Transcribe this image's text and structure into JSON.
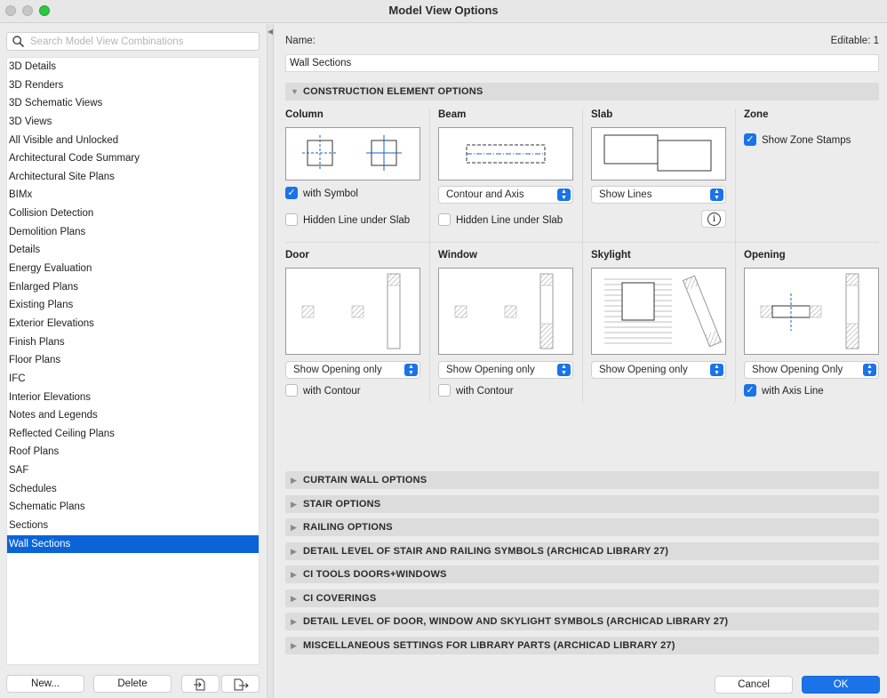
{
  "window": {
    "title": "Model View Options"
  },
  "search": {
    "placeholder": "Search Model View Combinations",
    "icon": "search-icon"
  },
  "list": {
    "items": [
      "3D Details",
      "3D Renders",
      "3D Schematic Views",
      "3D Views",
      "All Visible and Unlocked",
      "Architectural Code Summary",
      "Architectural Site Plans",
      "BIMx",
      "Collision Detection",
      "Demolition Plans",
      "Details",
      "Energy Evaluation",
      "Enlarged Plans",
      "Existing Plans",
      "Exterior Elevations",
      "Finish Plans",
      "Floor Plans",
      "IFC",
      "Interior Elevations",
      "Notes and Legends",
      "Reflected Ceiling Plans",
      "Roof Plans",
      "SAF",
      "Schedules",
      "Schematic Plans",
      "Sections",
      "Wall Sections"
    ],
    "selected": "Wall Sections"
  },
  "left_buttons": {
    "new": "New...",
    "delete": "Delete"
  },
  "header": {
    "name_label": "Name:",
    "editable": "Editable: 1",
    "name_value": "Wall Sections"
  },
  "construction": {
    "title": "CONSTRUCTION ELEMENT OPTIONS",
    "column": {
      "title": "Column",
      "with_symbol": "with Symbol",
      "hidden_line": "Hidden Line under Slab"
    },
    "beam": {
      "title": "Beam",
      "select": "Contour and Axis",
      "hidden_line": "Hidden Line under Slab"
    },
    "slab": {
      "title": "Slab",
      "select": "Show Lines"
    },
    "zone": {
      "title": "Zone",
      "show_stamps": "Show Zone Stamps"
    },
    "door": {
      "title": "Door",
      "select": "Show Opening only",
      "with_contour": "with Contour"
    },
    "window": {
      "title": "Window",
      "select": "Show Opening only",
      "with_contour": "with Contour"
    },
    "skylight": {
      "title": "Skylight",
      "select": "Show Opening only"
    },
    "opening": {
      "title": "Opening",
      "select": "Show Opening Only",
      "with_axis": "with Axis Line"
    }
  },
  "sections": [
    "CURTAIN WALL OPTIONS",
    "STAIR OPTIONS",
    "RAILING OPTIONS",
    "DETAIL LEVEL OF STAIR AND RAILING SYMBOLS (ARCHICAD LIBRARY 27)",
    "CI TOOLS DOORS+WINDOWS",
    "CI COVERINGS",
    "DETAIL LEVEL OF DOOR, WINDOW AND SKYLIGHT SYMBOLS (ARCHICAD LIBRARY 27)",
    "MISCELLANEOUS SETTINGS FOR LIBRARY PARTS (ARCHICAD LIBRARY 27)"
  ],
  "footer": {
    "cancel": "Cancel",
    "ok": "OK"
  },
  "colors": {
    "accent": "#1a73e8",
    "selection": "#0a64d8"
  }
}
